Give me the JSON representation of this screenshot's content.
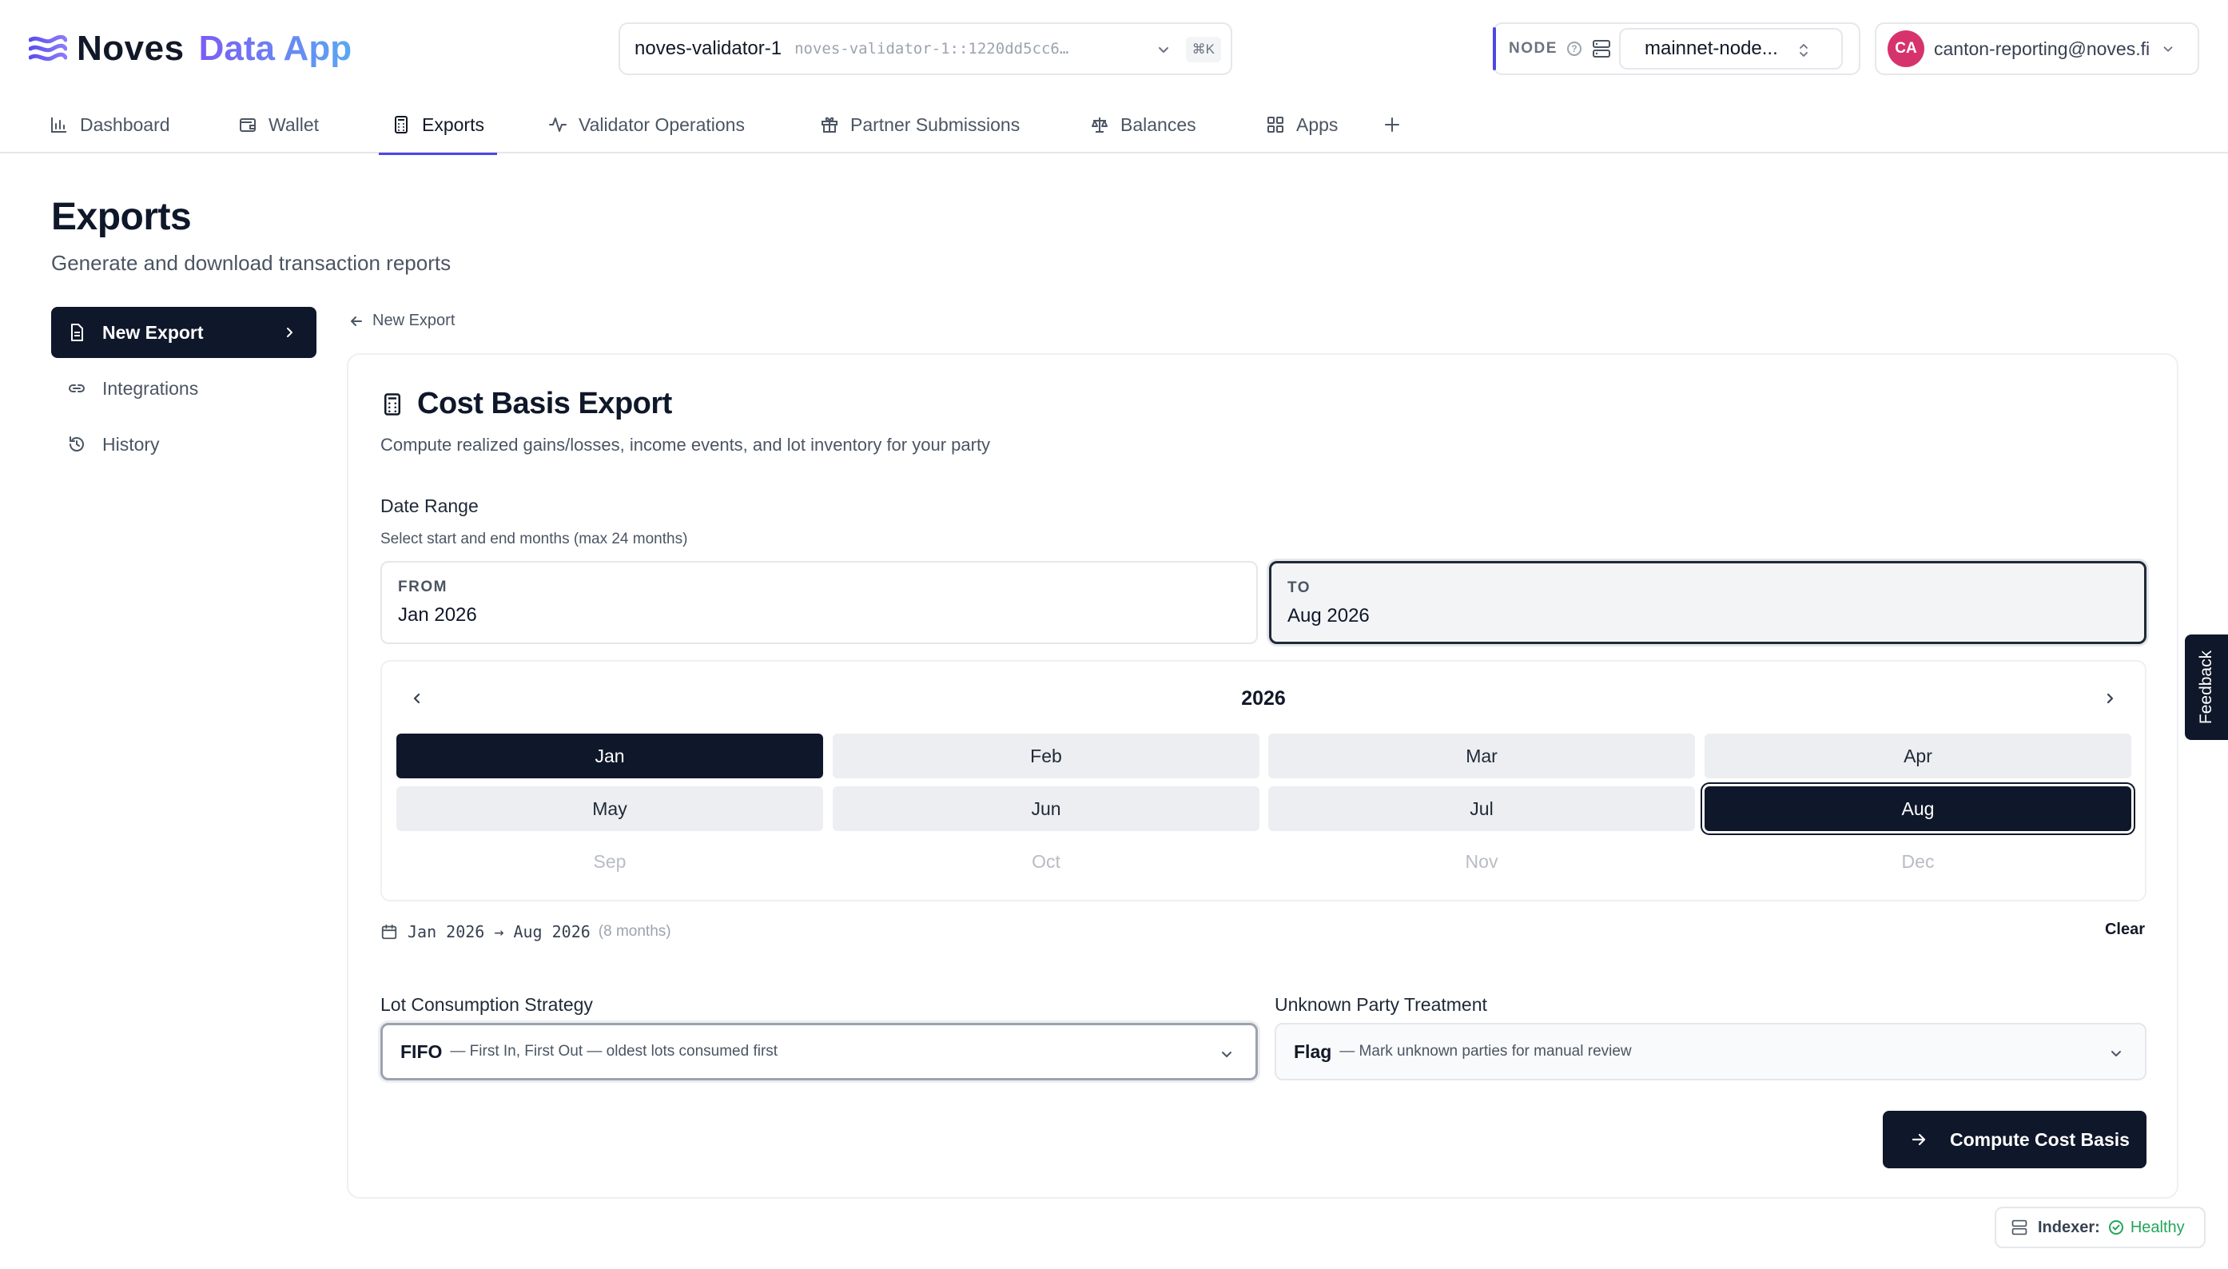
{
  "app": {
    "brand": "Noves",
    "brand_sub": "Data App",
    "logo_icon": "noves-waves-logo",
    "accent_color": "#4f46e5",
    "primary_color": "#0f172a"
  },
  "party_selector": {
    "name": "noves-validator-1",
    "id": "noves-validator-1::1220dd5cc6…",
    "shortcut": "⌘K"
  },
  "node": {
    "label": "NODE",
    "help_icon": "question-circle-icon",
    "server_icon": "server-icon",
    "selected": "mainnet-node..."
  },
  "user": {
    "initials": "CA",
    "email": "canton-reporting@noves.fi",
    "avatar_color": "#d6336c"
  },
  "tabs": [
    {
      "label": "Dashboard",
      "icon": "bar-chart-icon",
      "active": false
    },
    {
      "label": "Wallet",
      "icon": "wallet-icon",
      "active": false
    },
    {
      "label": "Exports",
      "icon": "calculator-icon",
      "active": true
    },
    {
      "label": "Validator Operations",
      "icon": "activity-icon",
      "active": false
    },
    {
      "label": "Partner Submissions",
      "icon": "gift-icon",
      "active": false
    },
    {
      "label": "Balances",
      "icon": "scale-icon",
      "active": false
    },
    {
      "label": "Apps",
      "icon": "grid-icon",
      "active": false
    }
  ],
  "page": {
    "title": "Exports",
    "subtitle": "Generate and download transaction reports"
  },
  "sidebar": {
    "items": [
      {
        "label": "New Export",
        "icon": "file-icon",
        "active": true
      },
      {
        "label": "Integrations",
        "icon": "link-icon",
        "active": false
      },
      {
        "label": "History",
        "icon": "history-icon",
        "active": false
      }
    ]
  },
  "back_link": {
    "label": "New Export"
  },
  "export_card": {
    "title": "Cost Basis Export",
    "description": "Compute realized gains/losses, income events, and lot inventory for your party",
    "date_range": {
      "label": "Date Range",
      "hint": "Select start and end months (max 24 months)",
      "from_caption": "FROM",
      "from_value": "Jan 2026",
      "to_caption": "TO",
      "to_value": "Aug 2026"
    },
    "calendar": {
      "year": "2026",
      "months": [
        {
          "label": "Jan",
          "state": "start"
        },
        {
          "label": "Feb",
          "state": "in-range"
        },
        {
          "label": "Mar",
          "state": "in-range"
        },
        {
          "label": "Apr",
          "state": "in-range"
        },
        {
          "label": "May",
          "state": "in-range"
        },
        {
          "label": "Jun",
          "state": "in-range"
        },
        {
          "label": "Jul",
          "state": "in-range"
        },
        {
          "label": "Aug",
          "state": "end"
        },
        {
          "label": "Sep",
          "state": "disabled"
        },
        {
          "label": "Oct",
          "state": "disabled"
        },
        {
          "label": "Nov",
          "state": "disabled"
        },
        {
          "label": "Dec",
          "state": "disabled"
        }
      ]
    },
    "range_summary": {
      "text": "Jan 2026 → Aug 2026",
      "count": "(8 months)",
      "clear_label": "Clear"
    },
    "lot_strategy": {
      "label": "Lot Consumption Strategy",
      "value": "FIFO",
      "value_desc": "— First In, First Out — oldest lots consumed first"
    },
    "unknown_party": {
      "label": "Unknown Party Treatment",
      "value": "Flag",
      "value_desc": "— Mark unknown parties for manual review"
    },
    "submit_label": "Compute Cost Basis"
  },
  "feedback_label": "Feedback",
  "indexer_status": {
    "label": "Indexer:",
    "state": "Healthy",
    "state_color": "#22a55a"
  }
}
